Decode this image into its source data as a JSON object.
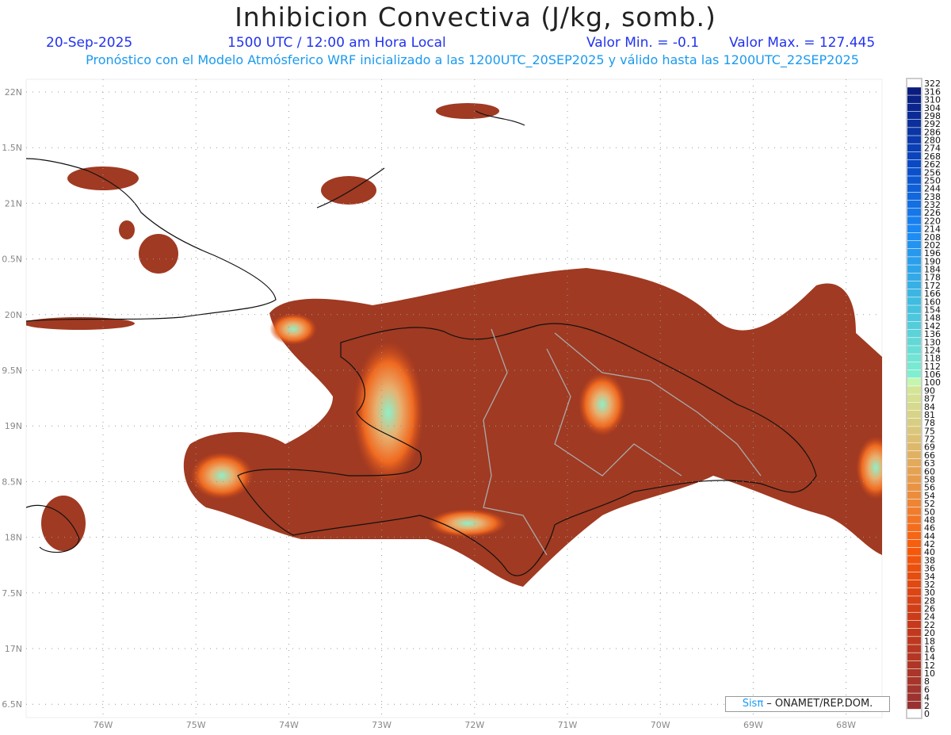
{
  "header": {
    "title": "Inhibicion Convectiva (J/kg, somb.)",
    "date": "20-Sep-2025",
    "time": "1500 UTC / 12:00 am Hora Local",
    "min": "Valor Min. = -0.1",
    "max": "Valor Max. = 127.445",
    "subtitle": "Pronóstico con el Modelo Atmósferico WRF inicializado a las 1200UTC_20SEP2025 y válido hasta las  1200UTC_22SEP2025"
  },
  "axes": {
    "lat_labels": [
      "22N",
      "1.5N",
      "21N",
      "0.5N",
      "20N",
      "9.5N",
      "19N",
      "8.5N",
      "18N",
      "7.5N",
      "17N",
      "6.5N"
    ],
    "lon_labels": [
      "76W",
      "75W",
      "74W",
      "73W",
      "72W",
      "71W",
      "70W",
      "69W",
      "68W"
    ]
  },
  "colorbar": {
    "labels": [
      "322",
      "316",
      "310",
      "304",
      "298",
      "292",
      "286",
      "280",
      "274",
      "268",
      "262",
      "256",
      "250",
      "244",
      "238",
      "232",
      "226",
      "220",
      "214",
      "208",
      "202",
      "196",
      "190",
      "184",
      "178",
      "172",
      "166",
      "160",
      "154",
      "148",
      "142",
      "136",
      "130",
      "124",
      "118",
      "112",
      "106",
      "100",
      "90",
      "87",
      "84",
      "81",
      "78",
      "75",
      "72",
      "69",
      "66",
      "63",
      "60",
      "58",
      "56",
      "54",
      "52",
      "50",
      "48",
      "46",
      "44",
      "42",
      "40",
      "38",
      "36",
      "34",
      "32",
      "30",
      "28",
      "26",
      "24",
      "22",
      "20",
      "18",
      "16",
      "14",
      "12",
      "10",
      "8",
      "6",
      "4",
      "2",
      "0"
    ],
    "stops": [
      [
        322,
        "#0a1878"
      ],
      [
        260,
        "#0a4cc8"
      ],
      [
        214,
        "#1a88f5"
      ],
      [
        160,
        "#40bde0"
      ],
      [
        106,
        "#80f0d0"
      ],
      [
        100,
        "#d2f7a8"
      ],
      [
        78,
        "#d8cc80"
      ],
      [
        60,
        "#e6a050"
      ],
      [
        42,
        "#f85a0a"
      ],
      [
        24,
        "#c83a1a"
      ],
      [
        2,
        "#963232"
      ],
      [
        0,
        "#ffffff"
      ]
    ]
  },
  "colors": {
    "field_dark": "#9a3522",
    "field_mid": "#c8461a",
    "field_orange": "#f06a20",
    "field_light": "#e8b070",
    "field_cyan": "#8ef0c8"
  },
  "credit": {
    "sis": "Sisπ",
    "org": " –  ONAMET/REP.DOM."
  }
}
